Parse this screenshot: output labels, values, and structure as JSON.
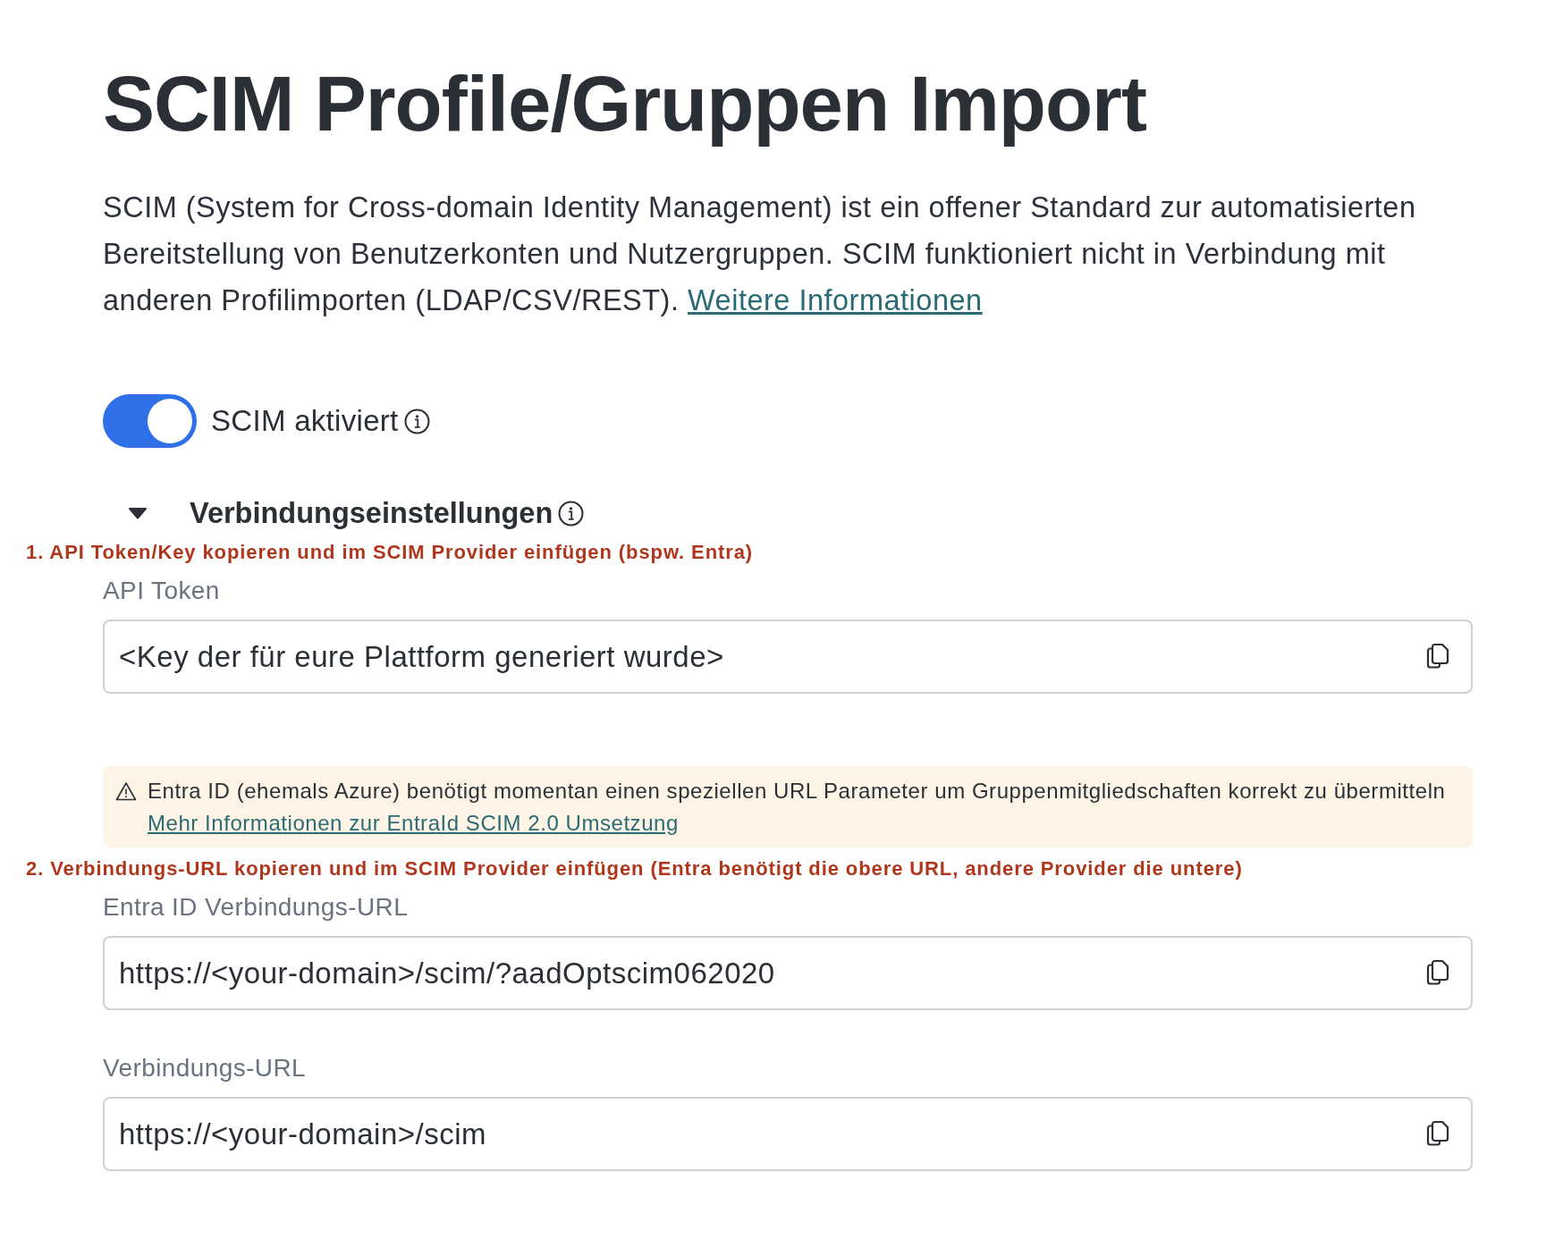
{
  "title": "SCIM Profile/Gruppen Import",
  "intro": {
    "text": "SCIM (System for Cross-domain Identity Management) ist ein offener Standard zur automatisierten Bereitstellung von Benutzerkonten und Nutzergruppen. SCIM funktioniert nicht in Verbindung mit anderen Profilimporten (LDAP/CSV/REST).",
    "link": "Weitere Informationen"
  },
  "scim_toggle": {
    "label": "SCIM aktiviert",
    "on": true
  },
  "connection_settings": {
    "title": "Verbindungseinstellungen",
    "expanded": true,
    "items": [
      {
        "kind": "annotation",
        "text": "1. API Token/Key kopieren und im SCIM Provider einfügen (bspw. Entra)"
      },
      {
        "kind": "field",
        "label": "API Token",
        "value": "<Key der für eure Plattform generiert wurde>"
      },
      {
        "kind": "notice",
        "text": "Entra ID (ehemals Azure) benötigt momentan einen speziellen URL Parameter um Gruppenmitgliedschaften korrekt zu übermitteln",
        "link": "Mehr Informationen zur EntraId SCIM 2.0 Umsetzung"
      },
      {
        "kind": "annotation",
        "text": "2. Verbindungs-URL kopieren und im SCIM Provider einfügen (Entra benötigt die obere URL, andere Provider die untere)"
      },
      {
        "kind": "field",
        "label": "Entra ID Verbindungs-URL",
        "value": "https://<your-domain>/scim/?aadOptscim062020"
      },
      {
        "kind": "field",
        "label": "Verbindungs-URL",
        "value": "https://<your-domain>/scim"
      }
    ]
  }
}
